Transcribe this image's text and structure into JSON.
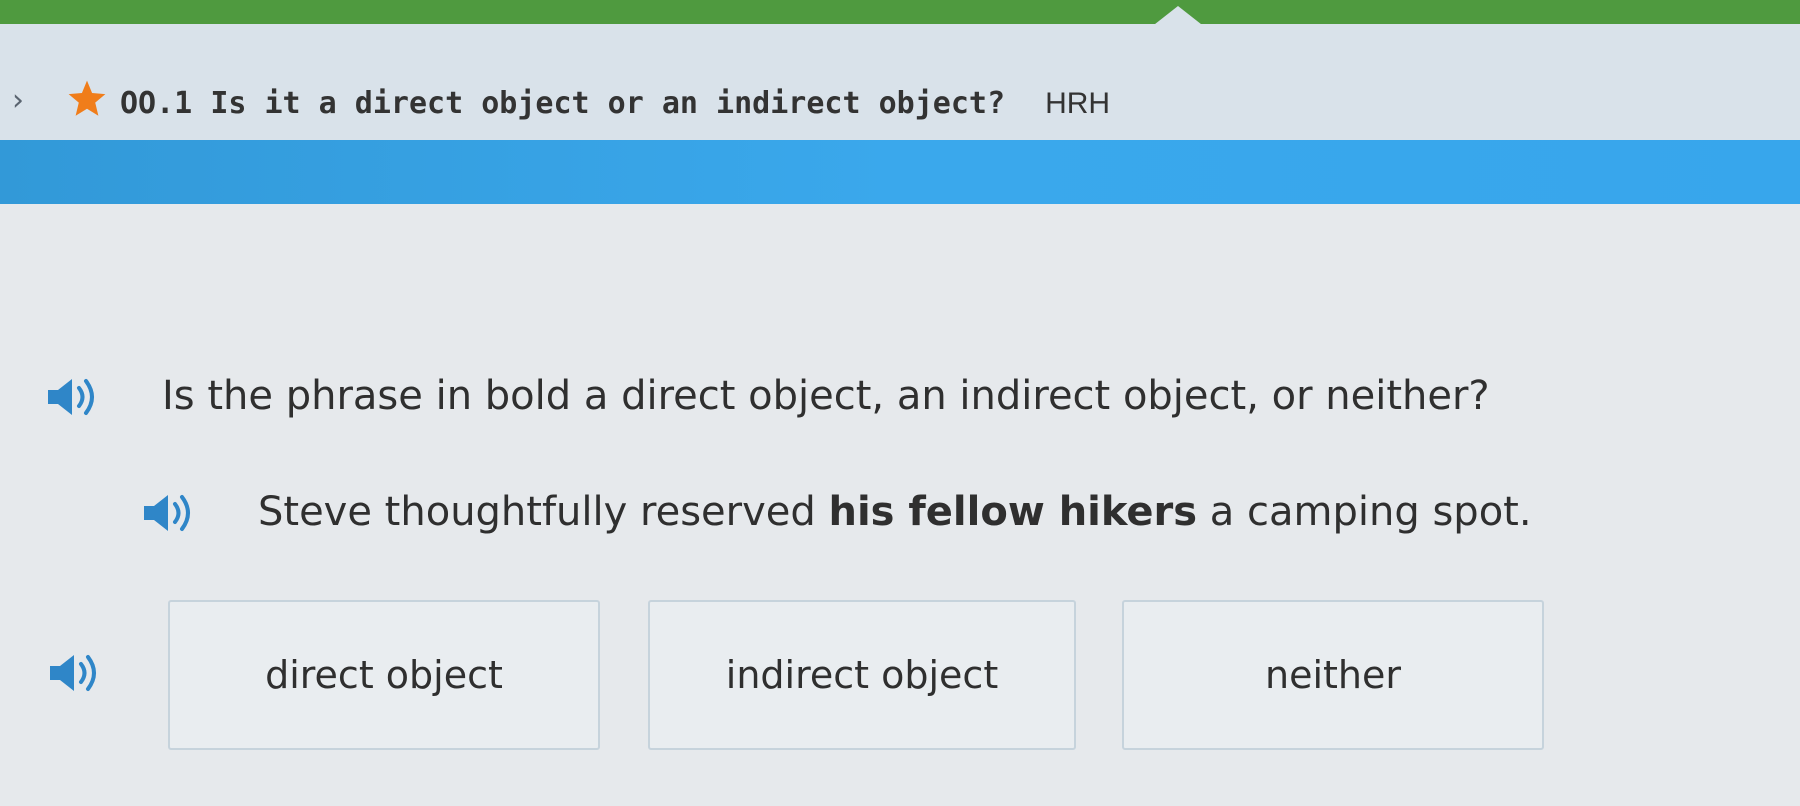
{
  "header": {
    "skill_code": "OO.1",
    "skill_title": "Is it a direct object or an indirect object?",
    "skill_tag": "HRH"
  },
  "colors": {
    "top_bar": "#4f9a3f",
    "header_bg": "#d9e2ea",
    "blue_bar": "#3aa8ec",
    "star": "#f07d1a",
    "speaker": "#2f86c8"
  },
  "icons": {
    "chevron": "chevron-right-icon",
    "star": "star-icon",
    "speaker": "speaker-icon"
  },
  "question": {
    "text": "Is the phrase in bold a direct object, an indirect object, or neither?"
  },
  "sentence": {
    "before": "Steve thoughtfully reserved ",
    "bold": "his fellow hikers",
    "after": " a camping spot."
  },
  "choices": [
    {
      "label": "direct object"
    },
    {
      "label": "indirect object"
    },
    {
      "label": "neither"
    }
  ]
}
